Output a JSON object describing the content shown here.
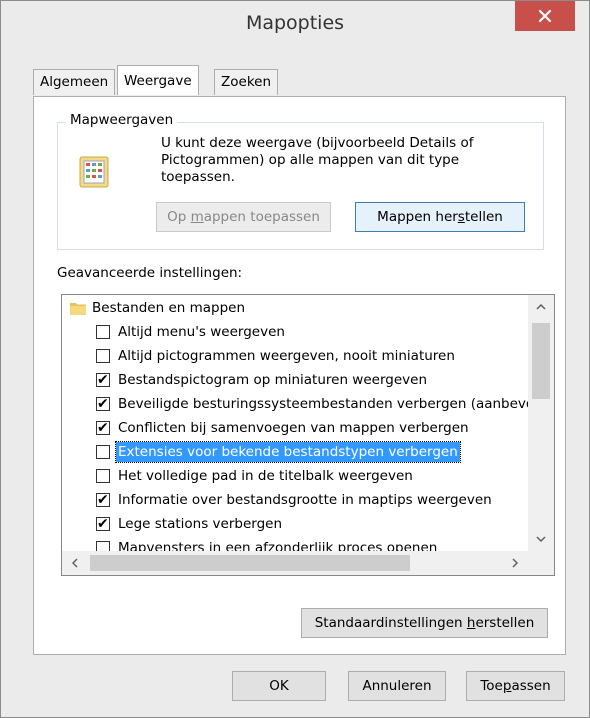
{
  "window": {
    "title": "Mapopties",
    "close_glyph": "✕"
  },
  "tabs": [
    {
      "label": "Algemeen",
      "active": false
    },
    {
      "label": "Weergave",
      "active": true
    },
    {
      "label": "Zoeken",
      "active": false
    }
  ],
  "folder_views": {
    "group_label": "Mapweergaven",
    "description": "U kunt deze weergave (bijvoorbeeld Details of Pictogrammen) op alle mappen van dit type toepassen.",
    "apply_button": {
      "pre": "Op ",
      "u": "m",
      "post": "appen toepassen"
    },
    "reset_button": {
      "pre": "Mappen her",
      "u": "s",
      "post": "tellen"
    }
  },
  "advanced": {
    "label": "Geavanceerde instellingen:",
    "category": "Bestanden en mappen",
    "items": [
      {
        "label": "Altijd menu's weergeven",
        "checked": false
      },
      {
        "label": "Altijd pictogrammen weergeven, nooit miniaturen",
        "checked": false
      },
      {
        "label": "Bestandspictogram op miniaturen weergeven",
        "checked": true
      },
      {
        "label": "Beveiligde besturingssysteembestanden verbergen (aanbevolen)",
        "checked": true
      },
      {
        "label": "Conflicten bij samenvoegen van mappen verbergen",
        "checked": true
      },
      {
        "label": "Extensies voor bekende bestandstypen verbergen",
        "checked": false,
        "selected": true
      },
      {
        "label": "Het volledige pad in de titelbalk weergeven",
        "checked": false
      },
      {
        "label": "Informatie over bestandsgrootte in maptips weergeven",
        "checked": true
      },
      {
        "label": "Lege stations verbergen",
        "checked": true
      },
      {
        "label": "Mapvensters in een afzonderlijk proces openen",
        "checked": false
      }
    ],
    "restore_defaults_button": {
      "pre": "Standaardinstellingen ",
      "u": "h",
      "post": "erstellen"
    }
  },
  "footer": {
    "ok_label": "OK",
    "cancel_label": "Annuleren",
    "apply_button": {
      "pre": "Toe",
      "u": "p",
      "post": "assen"
    }
  },
  "colors": {
    "selection": "#3399ff",
    "close_button": "#c7504a",
    "focus_border": "#3c7fb1"
  }
}
